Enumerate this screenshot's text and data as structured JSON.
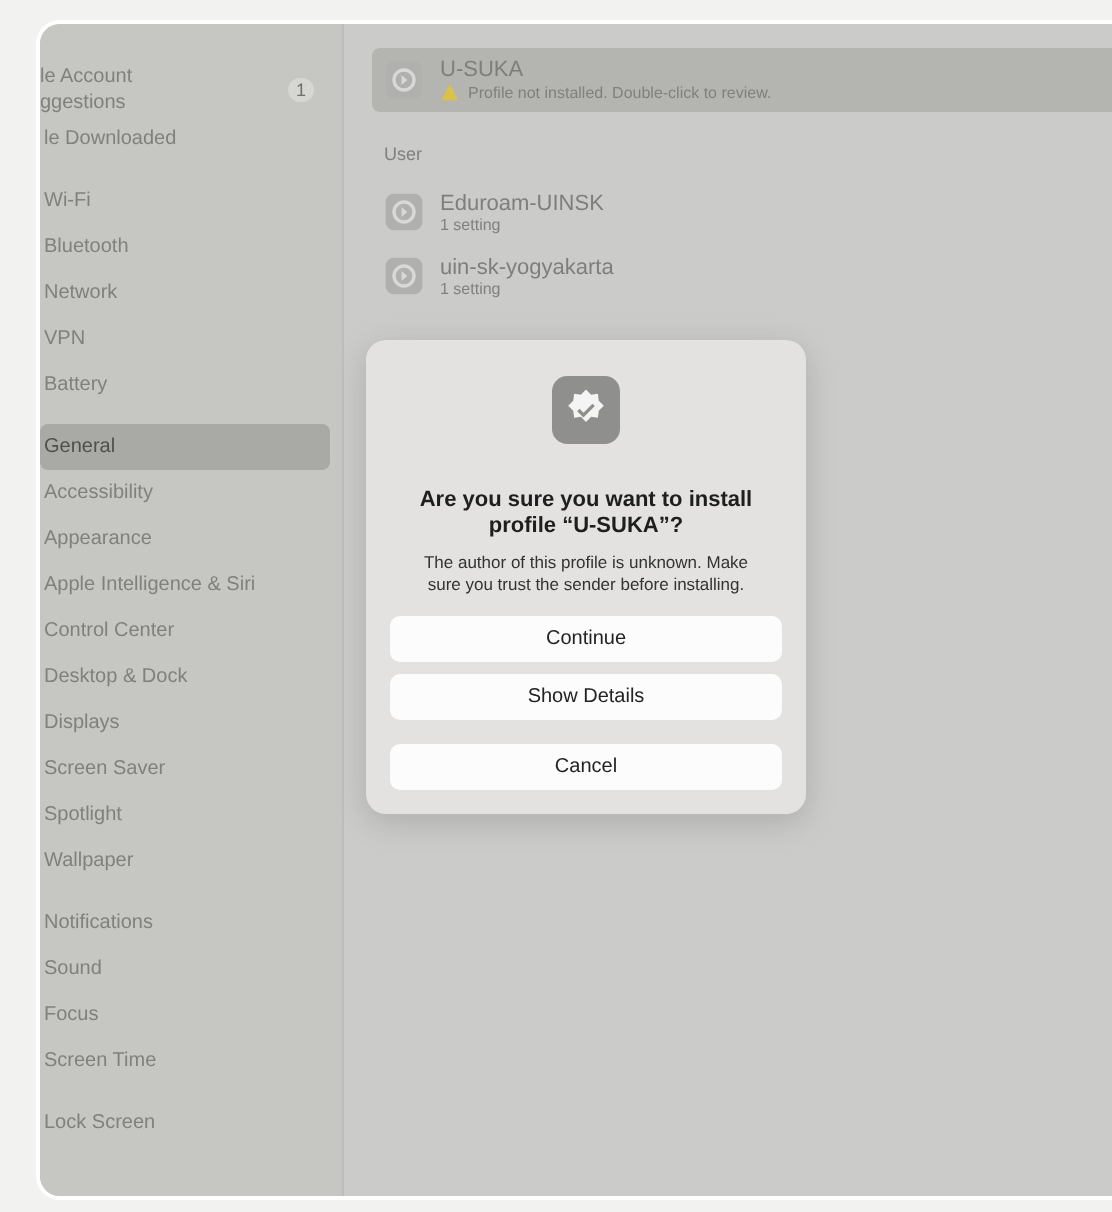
{
  "sidebar": {
    "account": {
      "lines": [
        "le Account",
        "ggestions"
      ],
      "badge": "1"
    },
    "downloaded": "le Downloaded",
    "groups": [
      [
        {
          "label": "Wi-Fi",
          "selected": false
        },
        {
          "label": "Bluetooth",
          "selected": false
        },
        {
          "label": "Network",
          "selected": false
        },
        {
          "label": "VPN",
          "selected": false
        },
        {
          "label": "Battery",
          "selected": false
        }
      ],
      [
        {
          "label": "General",
          "selected": true
        },
        {
          "label": "Accessibility",
          "selected": false
        },
        {
          "label": "Appearance",
          "selected": false
        },
        {
          "label": "Apple Intelligence & Siri",
          "selected": false
        },
        {
          "label": "Control Center",
          "selected": false
        },
        {
          "label": "Desktop & Dock",
          "selected": false
        },
        {
          "label": "Displays",
          "selected": false
        },
        {
          "label": "Screen Saver",
          "selected": false
        },
        {
          "label": "Spotlight",
          "selected": false
        },
        {
          "label": "Wallpaper",
          "selected": false
        }
      ],
      [
        {
          "label": "Notifications",
          "selected": false
        },
        {
          "label": "Sound",
          "selected": false
        },
        {
          "label": "Focus",
          "selected": false
        },
        {
          "label": "Screen Time",
          "selected": false
        }
      ],
      [
        {
          "label": "Lock Screen",
          "selected": false
        }
      ]
    ]
  },
  "profiles": {
    "sections": [
      {
        "items": [
          {
            "name": "U-SUKA",
            "detail": "Profile not installed. Double-click to review.",
            "warning": true,
            "selected": true
          }
        ]
      },
      {
        "title": "User",
        "items": [
          {
            "name": "Eduroam-UINSK",
            "detail": "1 setting",
            "warning": false,
            "selected": false
          },
          {
            "name": "uin-sk-yogyakarta",
            "detail": "1 setting",
            "warning": false,
            "selected": false
          }
        ]
      }
    ]
  },
  "dialog": {
    "title": "Are you sure you want to install profile “U-SUKA”?",
    "message": "The author of this profile is unknown. Make sure you trust the sender before installing.",
    "buttons": [
      "Continue",
      "Show Details"
    ],
    "cancel": "Cancel"
  }
}
